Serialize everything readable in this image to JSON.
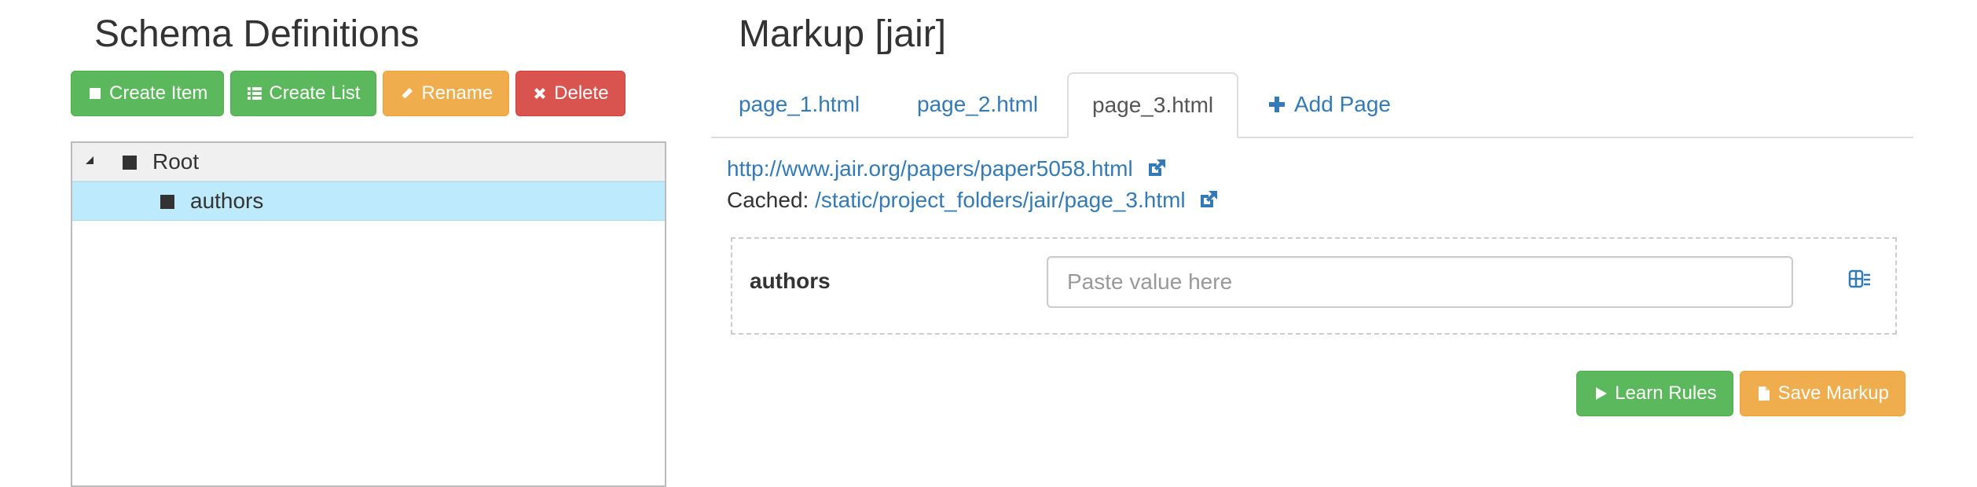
{
  "schema": {
    "title": "Schema Definitions",
    "toolbar": {
      "create_item": "Create Item",
      "create_list": "Create List",
      "rename": "Rename",
      "delete": "Delete"
    },
    "tree": {
      "root_label": "Root",
      "children": [
        "authors"
      ],
      "selected": "authors"
    }
  },
  "markup": {
    "title": "Markup [jair]",
    "tabs": [
      "page_1.html",
      "page_2.html",
      "page_3.html"
    ],
    "active_tab": "page_3.html",
    "add_page_label": "Add Page",
    "source_url": "http://www.jair.org/papers/paper5058.html",
    "cached_label": "Cached:",
    "cached_url": "/static/project_folders/jair/page_3.html",
    "field": {
      "label": "authors",
      "value": "",
      "placeholder": "Paste value here"
    },
    "actions": {
      "learn_rules": "Learn Rules",
      "save_markup": "Save Markup"
    }
  },
  "colors": {
    "success": "#5cb85c",
    "warning": "#f0ad4e",
    "danger": "#d9534f",
    "link": "#337ab7",
    "selected_row": "#bdeafc"
  },
  "icons": {
    "create_item": "square-icon",
    "create_list": "list-icon",
    "rename": "pencil-icon",
    "delete": "close-icon",
    "add_page": "plus-icon",
    "external_link": "external-link-icon",
    "field_tool": "table-icon",
    "learn_rules": "play-icon",
    "save_markup": "file-icon"
  }
}
